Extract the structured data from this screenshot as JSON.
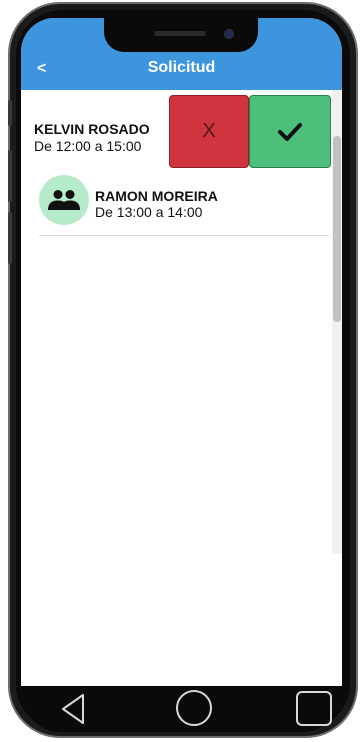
{
  "header": {
    "back_label": "<",
    "title": "Solicitud"
  },
  "requests": [
    {
      "name": "KELVIN ROSADO",
      "time": "De 12:00 a 15:00",
      "reject_label": "X",
      "accept_icon": "checkmark-icon"
    },
    {
      "name": "RAMON MOREIRA",
      "time": "De 13:00 a 14:00",
      "avatar_icon": "people-icon"
    }
  ],
  "navbar": {
    "icons": [
      "nav-back-icon",
      "nav-home-icon",
      "nav-recents-icon"
    ]
  },
  "colors": {
    "header": "#3d95dd",
    "reject": "#cf343f",
    "accept": "#4cbf7a",
    "avatar_bg": "#b5ebcb"
  }
}
